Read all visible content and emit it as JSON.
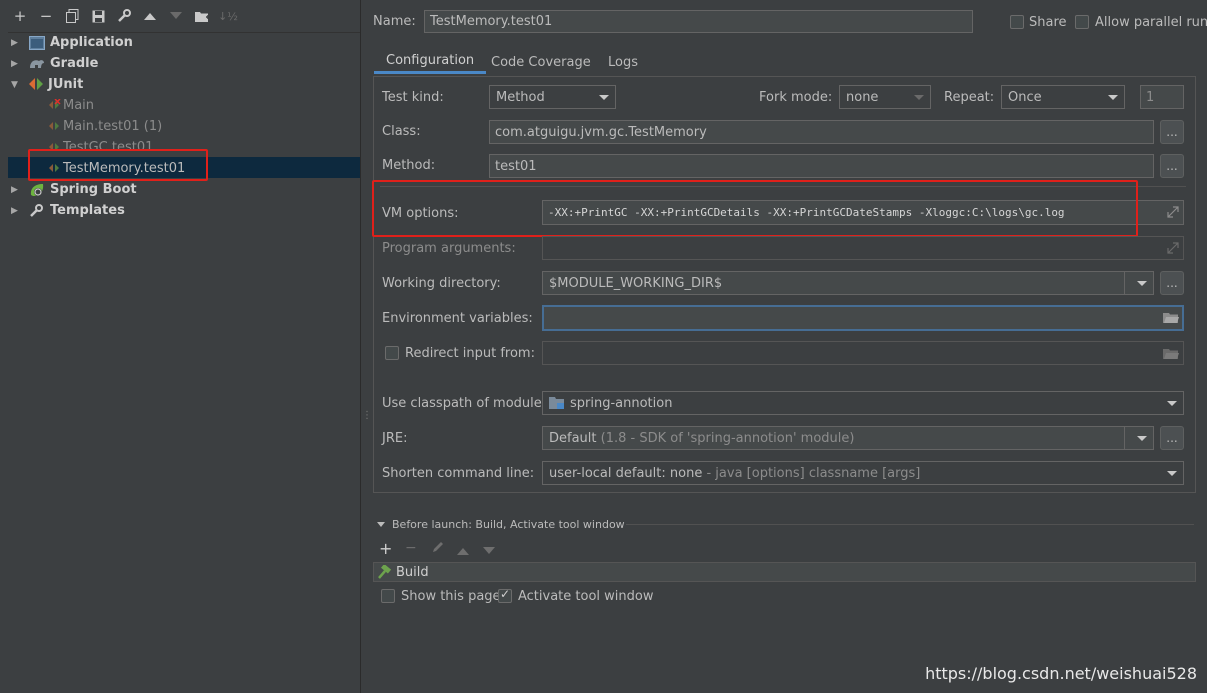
{
  "toolbar": {
    "icons": [
      "add-icon",
      "remove-icon",
      "copy-icon",
      "save-icon",
      "wrench-icon",
      "move-up-icon",
      "move-down-icon",
      "folder-add-icon",
      "sort-icon"
    ]
  },
  "tree": {
    "items": [
      {
        "label": "Application",
        "level": 0,
        "expanded": false
      },
      {
        "label": "Gradle",
        "level": 0,
        "expanded": false
      },
      {
        "label": "JUnit",
        "level": 0,
        "expanded": true
      },
      {
        "label": "Main",
        "level": 1
      },
      {
        "label": "Main.test01 (1)",
        "level": 1
      },
      {
        "label": "TestGC.test01",
        "level": 1
      },
      {
        "label": "TestMemory.test01",
        "level": 1,
        "selected": true
      },
      {
        "label": "Spring Boot",
        "level": 0,
        "expanded": false
      },
      {
        "label": "Templates",
        "level": 0,
        "expanded": false
      }
    ]
  },
  "header": {
    "name_label": "Name:",
    "name_value": "TestMemory.test01",
    "share_label": "Share",
    "allow_parallel_label": "Allow parallel run"
  },
  "tabs": [
    "Configuration",
    "Code Coverage",
    "Logs"
  ],
  "config": {
    "test_kind_label": "Test kind:",
    "test_kind_value": "Method",
    "fork_mode_label": "Fork mode:",
    "fork_mode_value": "none",
    "repeat_label": "Repeat:",
    "repeat_value": "Once",
    "repeat_count": "1",
    "class_label": "Class:",
    "class_value": "com.atguigu.jvm.gc.TestMemory",
    "method_label": "Method:",
    "method_value": "test01",
    "vm_label": "VM options:",
    "vm_value": "-XX:+PrintGC -XX:+PrintGCDetails -XX:+PrintGCDateStamps -Xloggc:C:\\logs\\gc.log",
    "program_args_label": "Program arguments:",
    "working_dir_label": "Working directory:",
    "working_dir_value": "$MODULE_WORKING_DIR$",
    "env_label": "Environment variables:",
    "redirect_label": "Redirect input from:",
    "classpath_label": "Use classpath of module:",
    "classpath_value": "spring-annotion",
    "jre_label": "JRE:",
    "jre_value": "Default",
    "jre_detail": "(1.8 - SDK of 'spring-annotion' module)",
    "shorten_label": "Shorten command line:",
    "shorten_value": "user-local default: none",
    "shorten_detail": "- java [options] classname [args]",
    "ellipsis": "..."
  },
  "before_launch": {
    "title": "Before launch: Build, Activate tool window",
    "task": "Build",
    "show_page_label": "Show this page",
    "activate_label": "Activate tool window"
  },
  "watermark": "https://blog.csdn.net/weishuai528"
}
